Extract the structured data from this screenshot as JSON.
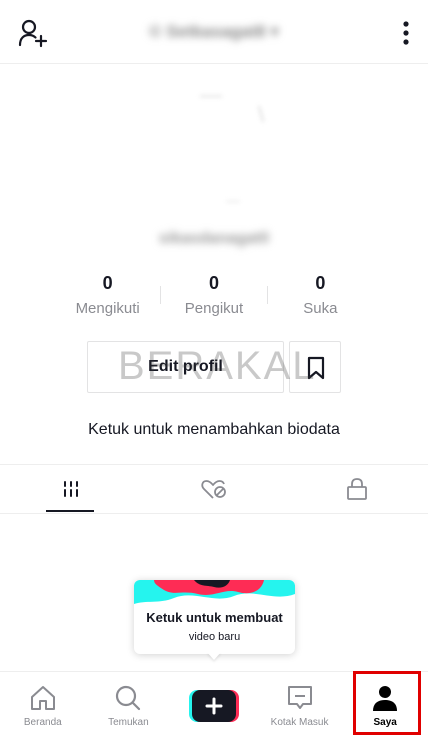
{
  "header": {
    "username": "© Setkasagat8 ▾"
  },
  "profile": {
    "handle": "sikasdanagat0"
  },
  "stats": [
    {
      "value": "0",
      "label": "Mengikuti"
    },
    {
      "value": "0",
      "label": "Pengikut"
    },
    {
      "value": "0",
      "label": "Suka"
    }
  ],
  "actions": {
    "edit_label": "Edit profil"
  },
  "watermark": "BERAKAL",
  "bio_prompt": "Ketuk untuk menambahkan biodata",
  "tabs": [
    {
      "icon": "grid-icon",
      "active": true
    },
    {
      "icon": "liked-hidden-icon",
      "active": false
    },
    {
      "icon": "lock-icon",
      "active": false
    }
  ],
  "popup": {
    "title": "Ketuk untuk membuat",
    "subtitle": "video baru"
  },
  "nav": [
    {
      "label": "Beranda",
      "icon": "home-icon"
    },
    {
      "label": "Temukan",
      "icon": "search-icon"
    },
    {
      "label": "",
      "icon": "plus-icon"
    },
    {
      "label": "Kotak Masuk",
      "icon": "inbox-icon"
    },
    {
      "label": "Saya",
      "icon": "profile-icon",
      "active": true
    }
  ],
  "colors": {
    "highlight": "#e00000",
    "cyan": "#25f4ee",
    "red": "#fe2c55"
  }
}
